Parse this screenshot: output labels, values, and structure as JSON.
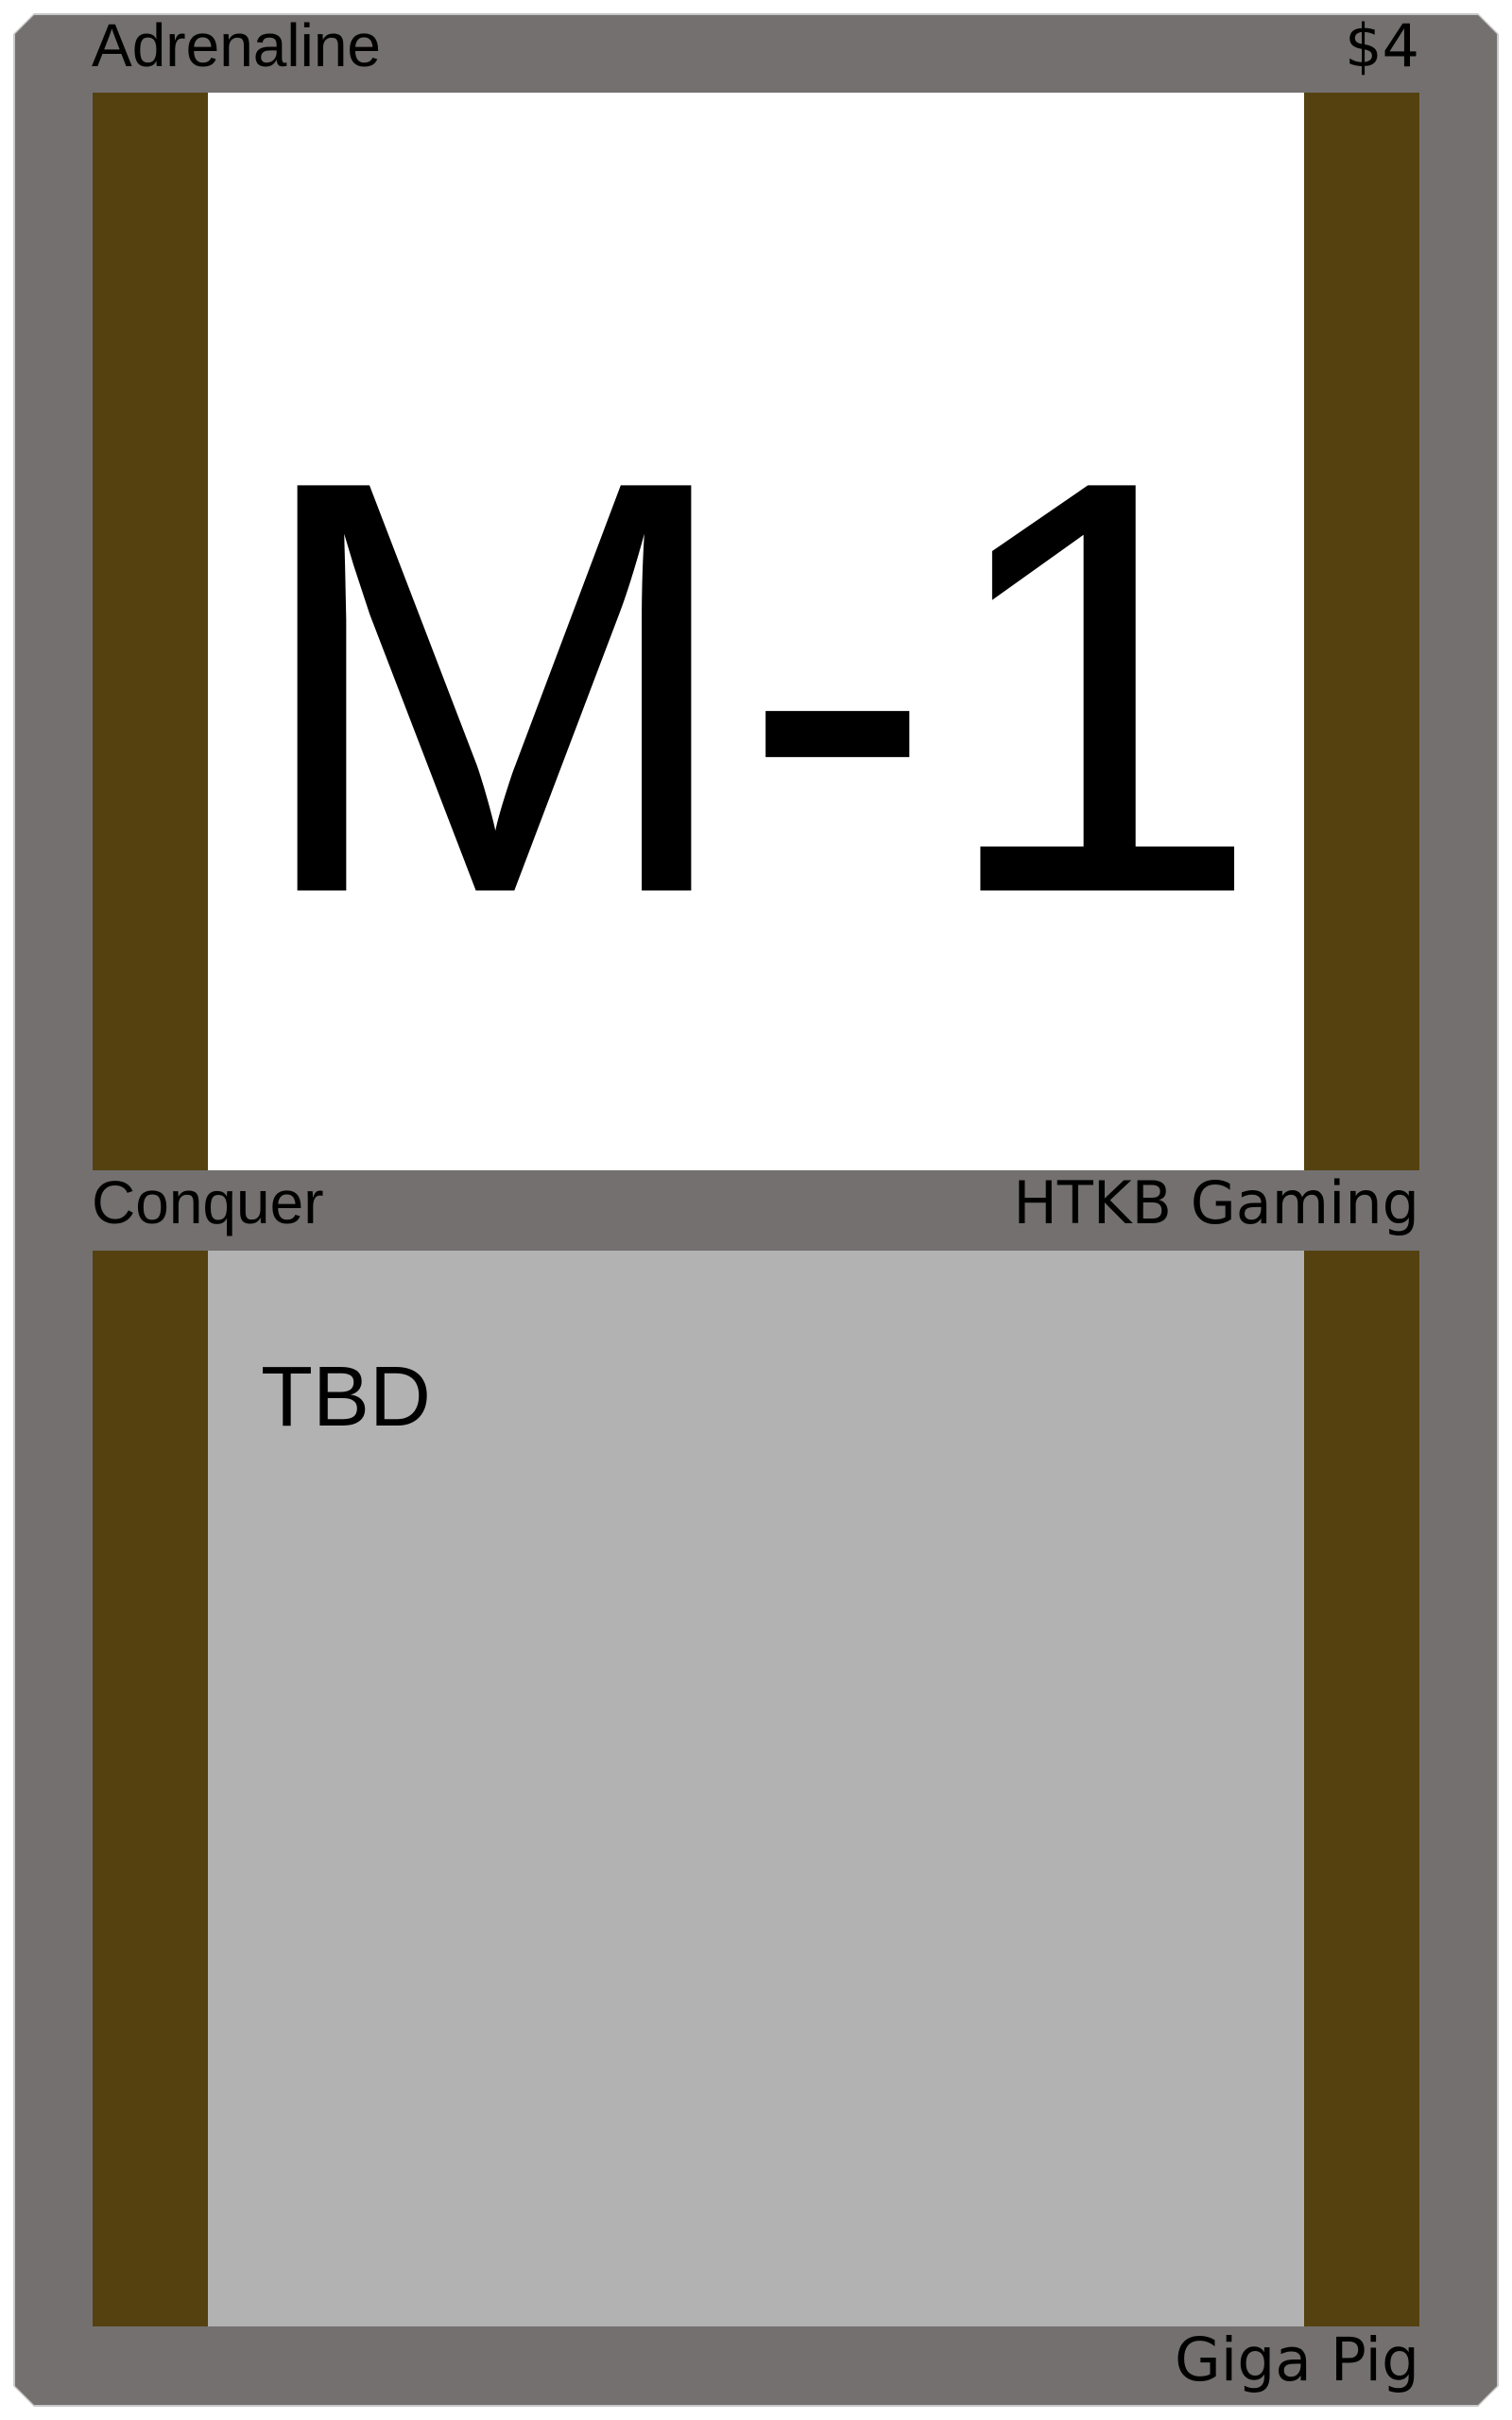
{
  "card": {
    "name": "Adrenaline",
    "cost": "$4",
    "art_text": "M-1",
    "type": "Conquer",
    "publisher": "HTKB Gaming",
    "rules_text": "TBD",
    "creature": "Giga Pig"
  },
  "colors": {
    "frame": "#73706f",
    "side_bars": "#54410f",
    "art_bg": "#ffffff",
    "text_bg": "#b2b2b2"
  }
}
